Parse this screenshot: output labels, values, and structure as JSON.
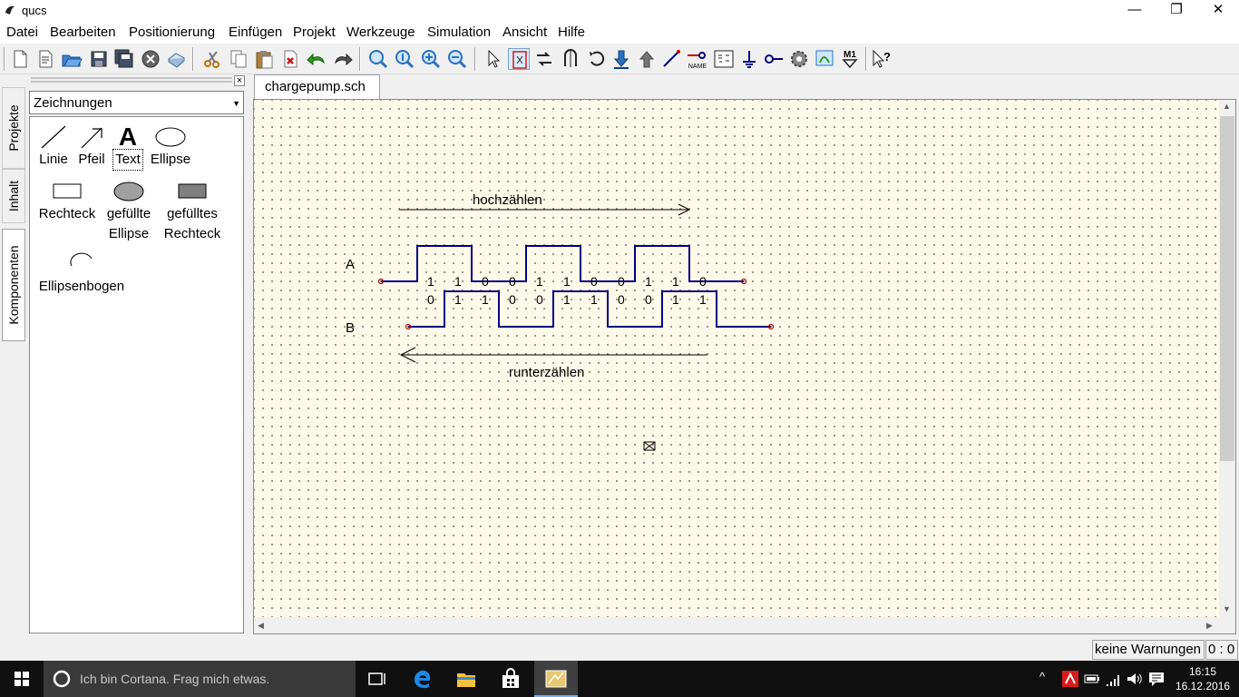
{
  "window": {
    "title": "qucs",
    "minimize": "—",
    "restore": "❐",
    "close": "✕"
  },
  "menu": [
    "Datei",
    "Bearbeiten",
    "Positionierung",
    "Einfügen",
    "Projekt",
    "Werkzeuge",
    "Simulation",
    "Ansicht",
    "Hilfe"
  ],
  "toolbar": {
    "label_name": "NAME",
    "label_m1": "M1"
  },
  "sidebar": {
    "tabs": [
      "Projekte",
      "Inhalt",
      "Komponenten"
    ],
    "active_tab": "Komponenten",
    "close": "×",
    "category": "Zeichnungen",
    "items": {
      "line": "Linie",
      "arrow": "Pfeil",
      "text": "Text",
      "text_glyph": "A",
      "ellipse": "Ellipse",
      "rectangle": "Rechteck",
      "filled_ellipse_1": "gefüllte",
      "filled_ellipse_2": "Ellipse",
      "filled_rect_1": "gefülltes",
      "filled_rect_2": "Rechteck",
      "arc": "Ellipsenbogen"
    }
  },
  "document": {
    "tab": "chargepump.sch"
  },
  "schematic": {
    "label_up": "hochzählen",
    "label_down": "runterzählen",
    "signal_a": "A",
    "signal_b": "B",
    "bits_a": [
      "1",
      "1",
      "0",
      "0",
      "1",
      "1",
      "0",
      "0",
      "1",
      "1",
      "0"
    ],
    "bits_b": [
      "0",
      "1",
      "1",
      "0",
      "0",
      "1",
      "1",
      "0",
      "0",
      "1",
      "1"
    ],
    "wave_color": "#00007f",
    "port_color": "#b00000"
  },
  "status": {
    "warnings": "keine Warnungen",
    "position": "0 : 0"
  },
  "taskbar": {
    "search": "Ich bin Cortana. Frag mich etwas.",
    "time": "16:15",
    "date": "16.12.2016"
  }
}
